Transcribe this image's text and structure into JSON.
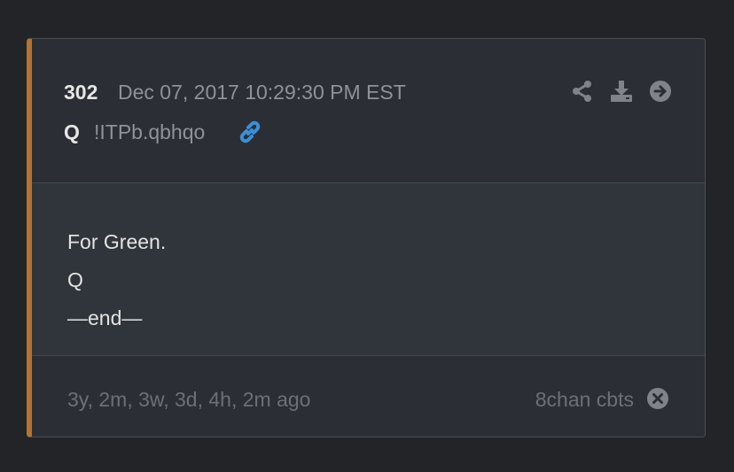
{
  "post": {
    "number": "302",
    "date": "Dec 07, 2017 10:29:30 PM EST",
    "author": "Q",
    "tripcode": "!ITPb.qbhqo",
    "body_lines": [
      "For Green.",
      "Q",
      "—end—"
    ],
    "time_ago": "3y, 2m, 3w, 3d, 4h, 2m ago",
    "source": "8chan cbts"
  },
  "icons": {
    "link": "link-icon",
    "share": "share-icon",
    "download": "download-icon",
    "goto": "arrow-right-circle-icon",
    "close": "close-circle-icon"
  },
  "colors": {
    "accent_bar": "#b5732f",
    "link_blue": "#3b8fd9",
    "icon_gray": "#7f838a"
  }
}
